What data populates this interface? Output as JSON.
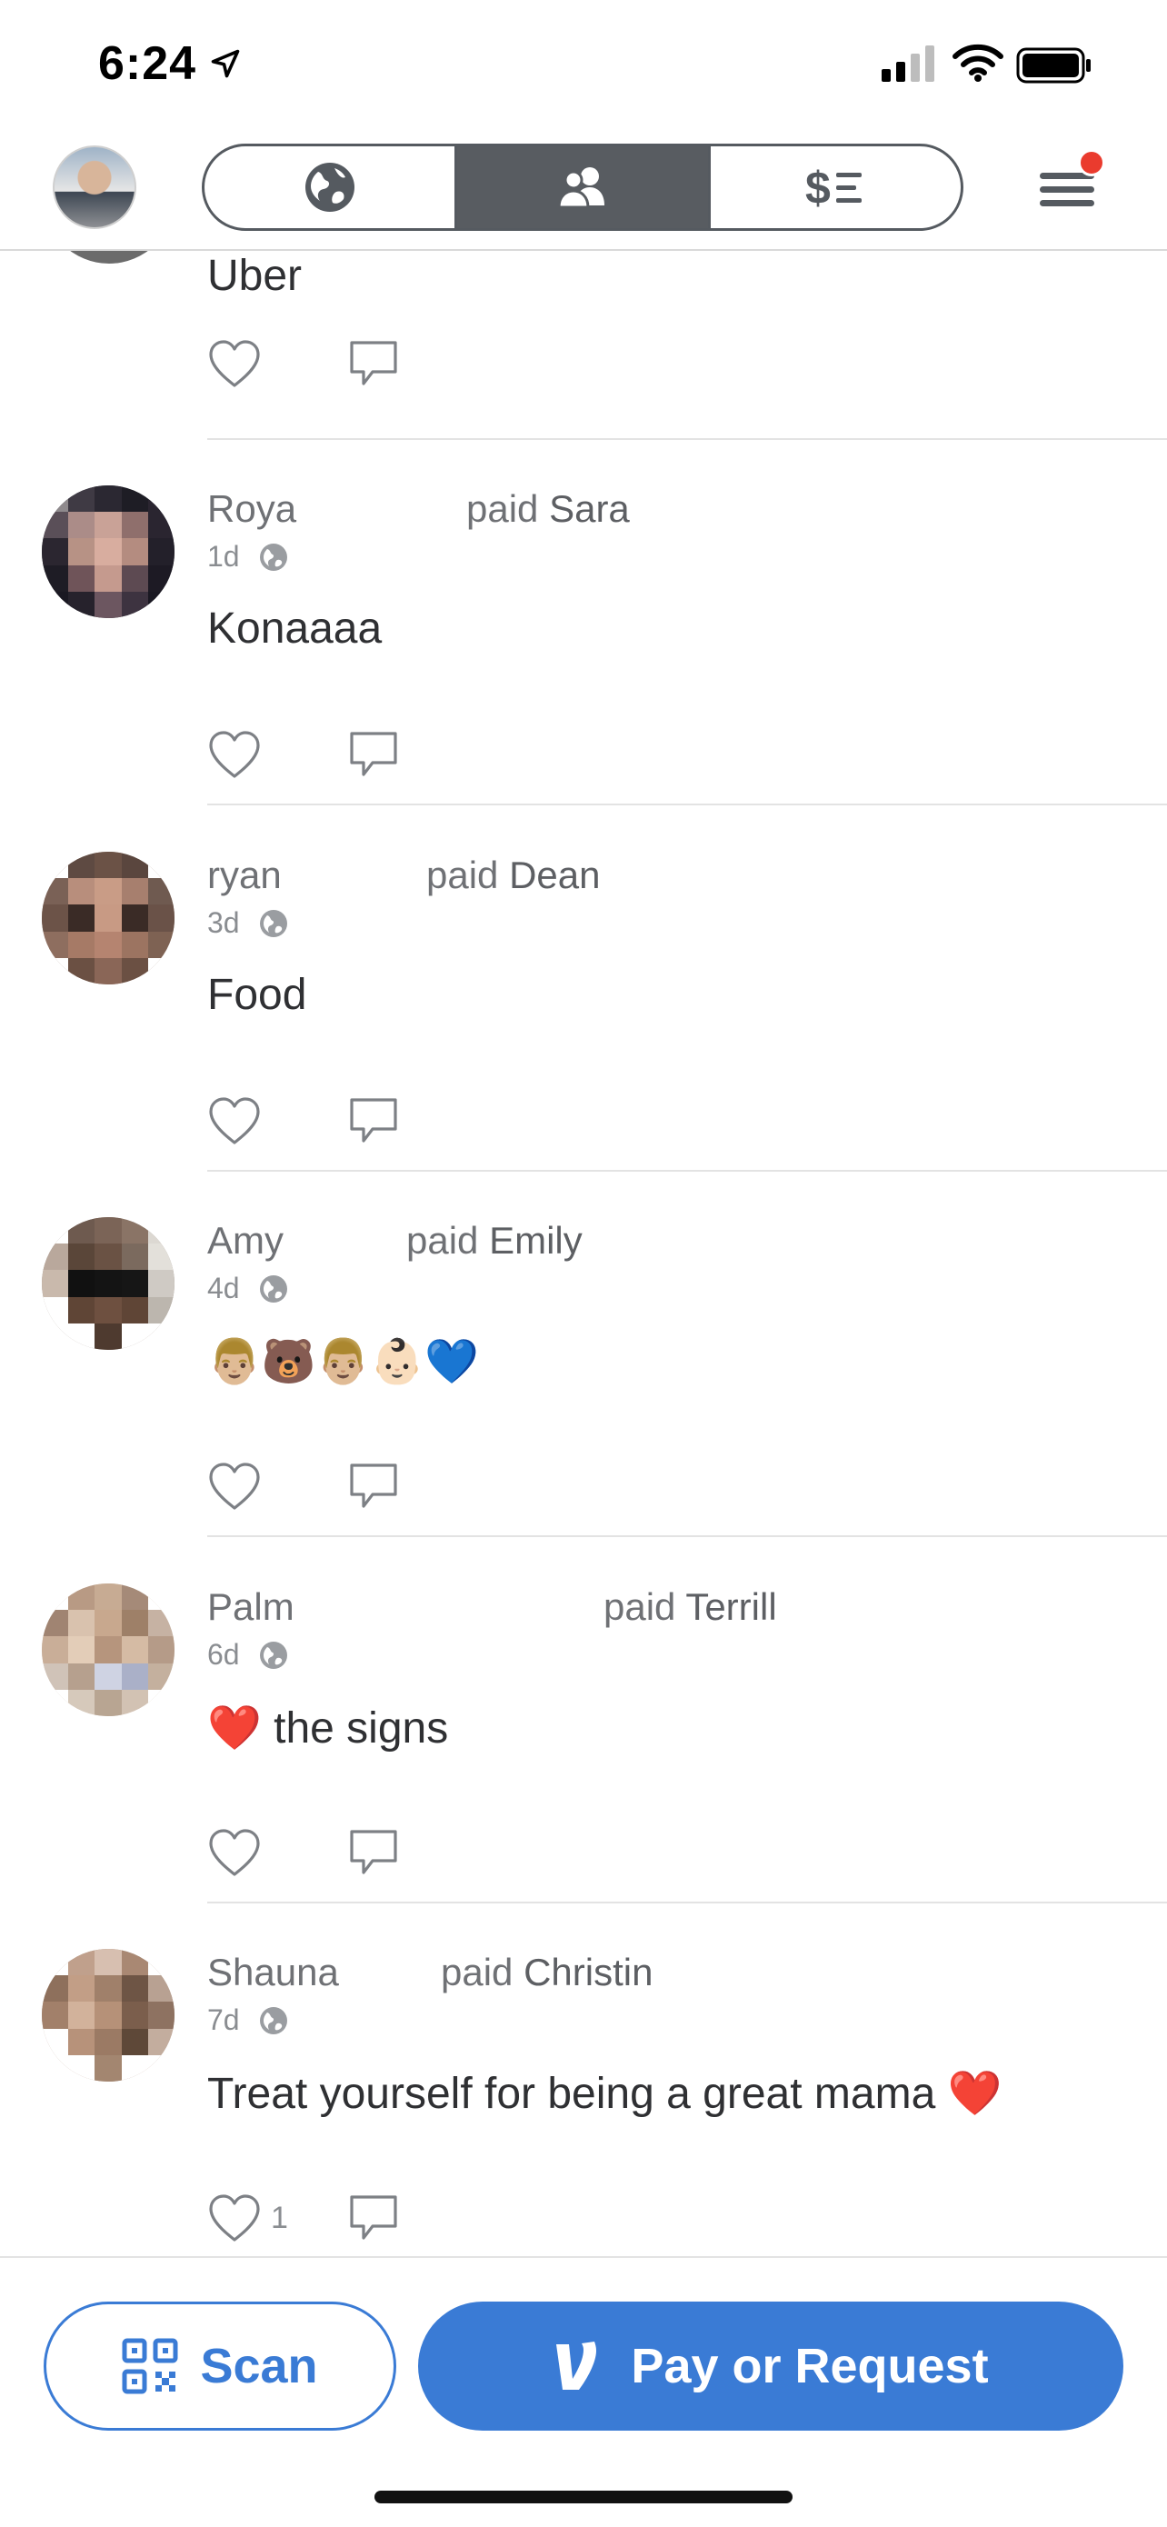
{
  "status_bar": {
    "time": "6:24"
  },
  "nav": {
    "tabs": [
      {
        "name": "public",
        "icon": "globe-icon"
      },
      {
        "name": "friends",
        "icon": "friends-icon",
        "active": true
      },
      {
        "name": "mine",
        "icon": "dollar-list-icon"
      }
    ],
    "menu_has_notification": true
  },
  "partial_story": {
    "note": "Uber"
  },
  "stories": [
    {
      "actor": "Roya",
      "paid_word": "paid",
      "target": "Sara",
      "time": "1d",
      "note": "Konaaaa",
      "likes": ""
    },
    {
      "actor": "ryan",
      "paid_word": "paid",
      "target": "Dean",
      "time": "3d",
      "note": "Food",
      "likes": ""
    },
    {
      "actor": "Amy",
      "paid_word": "paid",
      "target": "Emily",
      "time": "4d",
      "note": "👨🏼🐻👨🏼👶🏻💙",
      "likes": ""
    },
    {
      "actor": "Palm",
      "paid_word": "paid",
      "target": "Terrill",
      "time": "6d",
      "note": "❤️ the signs",
      "likes": ""
    },
    {
      "actor": "Shauna",
      "paid_word": "paid",
      "target": "Christin",
      "time": "7d",
      "note": "Treat yourself for being a great mama ❤️",
      "likes": "1"
    }
  ],
  "bottom": {
    "scan_label": "Scan",
    "pay_label": "Pay or Request"
  },
  "colors": {
    "accent": "#3a7bd5",
    "active_tab": "#585c61",
    "notification": "#ea3b2e"
  }
}
